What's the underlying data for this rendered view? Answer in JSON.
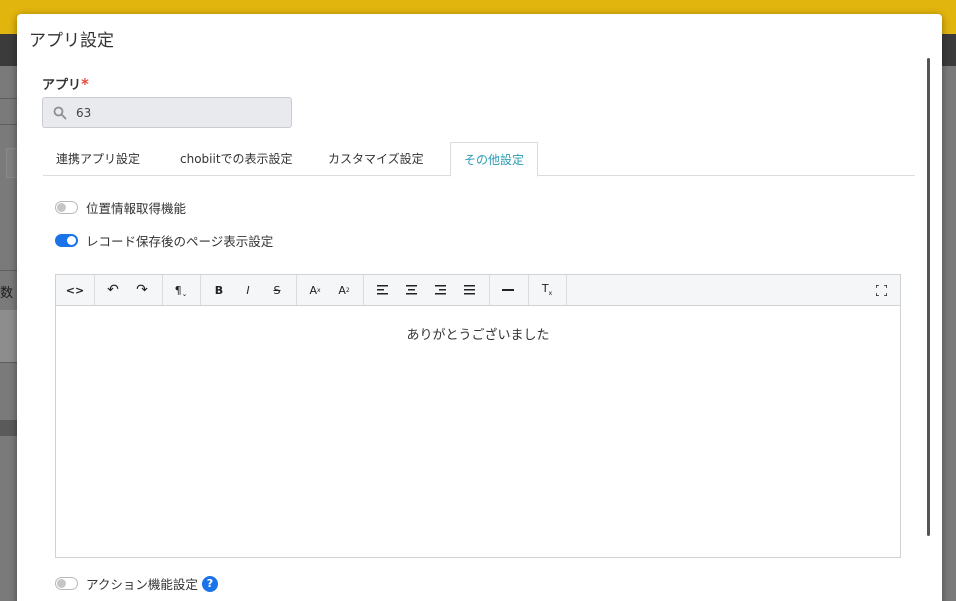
{
  "background": {
    "column_label": "数"
  },
  "modal": {
    "title": "アプリ設定",
    "app_field": {
      "label": "アプリ",
      "required_mark": "*",
      "value": "63",
      "icon": "search-icon"
    },
    "tabs": [
      {
        "label": "連携アプリ設定",
        "active": false
      },
      {
        "label": "chobiitでの表示設定",
        "active": false
      },
      {
        "label": "カスタマイズ設定",
        "active": false
      },
      {
        "label": "その他設定",
        "active": true
      }
    ],
    "toggles": {
      "location": {
        "label": "位置情報取得機能",
        "on": false
      },
      "after_save": {
        "label": "レコード保存後のページ表示設定",
        "on": true
      },
      "action": {
        "label": "アクション機能設定",
        "on": false
      }
    },
    "editor": {
      "toolbar": {
        "code": "<>",
        "undo": "↶",
        "redo": "↷",
        "paragraph": "¶",
        "bold": "B",
        "italic": "I",
        "strike": "S",
        "superscript": "A",
        "subscript": "A",
        "fullscreen": "⛶"
      },
      "content": "ありがとうございました"
    },
    "help_icon": "?"
  },
  "colors": {
    "accent": "#2a9cb5",
    "toggle_on": "#1a73e8",
    "header_yellow": "#e2b40e",
    "required": "#e64d3d"
  }
}
